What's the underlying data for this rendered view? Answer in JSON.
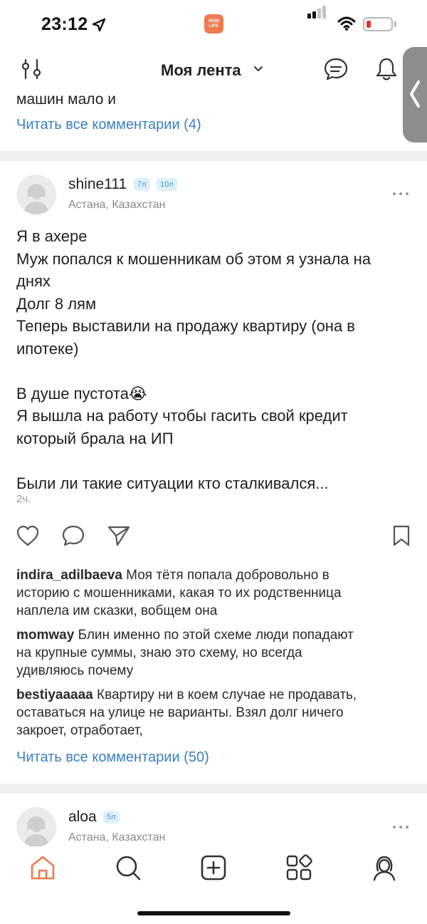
{
  "status_bar": {
    "time": "23:12",
    "app_badge_line1": "MOM",
    "app_badge_line2": "LIFE",
    "battery_color": "#e5352d"
  },
  "top_nav": {
    "title": "Моя лента",
    "icons": [
      "filter-icon",
      "chevron-down-icon",
      "chat-icon",
      "bell-icon"
    ]
  },
  "side_tab": {
    "icon": "chevron-left-icon"
  },
  "previous_post": {
    "comment_tail": "машин мало и",
    "read_all_comments": "Читать все комментарии (4)"
  },
  "post": {
    "username": "shine111",
    "badges": [
      "7л",
      "10л"
    ],
    "location": "Астана, Казахстан",
    "body": [
      "Я в ахере",
      "Муж попался к мошенникам об этом я узнала на",
      "днях",
      "Долг 8 лям",
      "Теперь выставили на продажу квартиру (она в",
      "ипотеке)",
      "",
      "В душе пустота😭",
      "Я вышла на работу чтобы гасить свой кредит",
      "который брала на ИП",
      "",
      "Были ли такие ситуации кто сталкивался..."
    ],
    "time": "2ч.",
    "actions": [
      "heart-icon",
      "comment-icon",
      "share-icon",
      "bookmark-icon"
    ],
    "comments": [
      {
        "author": "indira_adilbaeva",
        "text": " Моя тётя попала добровольно в",
        "lines": [
          "историю с мошенниками, какая то их родственница",
          "наплела им сказки, вобщем она"
        ]
      },
      {
        "author": "momway",
        "text": " Блин именно по этой схеме люди попадают",
        "lines": [
          "на крупные суммы, знаю это схему, но всегда",
          "удивляюсь почему"
        ]
      },
      {
        "author": "bestiyaaaaa",
        "text": " Квартиру ни в коем случае не продавать,",
        "lines": [
          "оставаться на улице не варианты. Взял долг ничего",
          "закроет, отработает,"
        ]
      }
    ],
    "read_all_comments": "Читать все комментарии (50)"
  },
  "next_post": {
    "username": "aloa",
    "badges": [
      "5л"
    ],
    "location": "Астана, Казахстан"
  },
  "bottom_tabs": [
    {
      "icon": "home-icon",
      "active": true
    },
    {
      "icon": "search-icon",
      "active": false
    },
    {
      "icon": "add-icon",
      "active": false
    },
    {
      "icon": "categories-icon",
      "active": false
    },
    {
      "icon": "profile-icon",
      "active": false
    }
  ],
  "colors": {
    "accent": "#f07a4f",
    "link": "#3a7fc1",
    "badge_text": "#4a9bc5"
  }
}
